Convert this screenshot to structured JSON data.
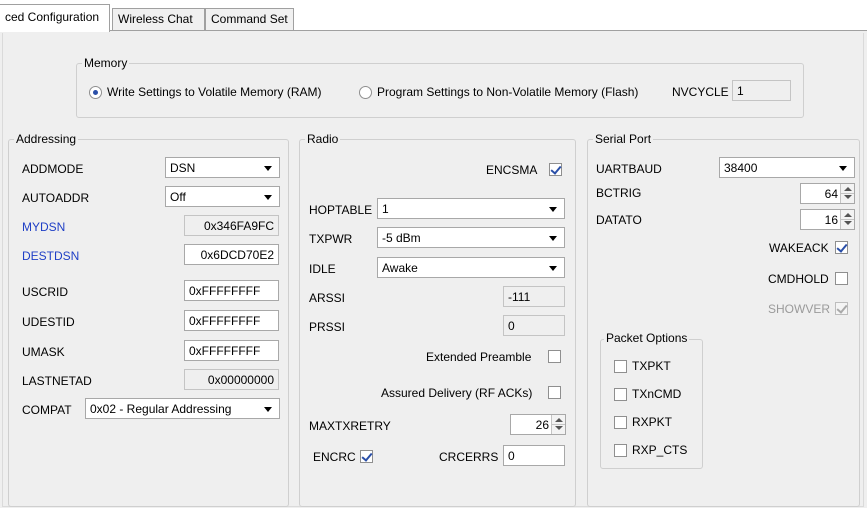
{
  "tabs": [
    "ced Configuration",
    "Wireless Chat",
    "Command Set"
  ],
  "memory": {
    "title": "Memory",
    "option_ram": "Write Settings to Volatile Memory (RAM)",
    "option_flash": "Program Settings to Non-Volatile Memory (Flash)",
    "selected": "option_ram",
    "nvcycle_label": "NVCYCLE",
    "nvcycle_value": "1"
  },
  "addressing": {
    "title": "Addressing",
    "addmode_label": "ADDMODE",
    "addmode_value": "DSN",
    "autoaddr_label": "AUTOADDR",
    "autoaddr_value": "Off",
    "mydsn_label": "MYDSN",
    "mydsn_value": "0x346FA9FC",
    "destdsn_label": "DESTDSN",
    "destdsn_value": "0x6DCD70E2",
    "uscrid_label": "USCRID",
    "uscrid_value": "0xFFFFFFFF",
    "udestid_label": "UDESTID",
    "udestid_value": "0xFFFFFFFF",
    "umask_label": "UMASK",
    "umask_value": "0xFFFFFFFF",
    "lastnetad_label": "LASTNETAD",
    "lastnetad_value": "0x00000000",
    "compat_label": "COMPAT",
    "compat_value": "0x02 - Regular Addressing"
  },
  "radio": {
    "title": "Radio",
    "encsma_label": "ENCSMA",
    "encsma_checked": true,
    "hoptable_label": "HOPTABLE",
    "hoptable_value": "1",
    "txpwr_label": "TXPWR",
    "txpwr_value": "-5 dBm",
    "idle_label": "IDLE",
    "idle_value": "Awake",
    "arssi_label": "ARSSI",
    "arssi_value": "-111",
    "prssi_label": "PRSSI",
    "prssi_value": "0",
    "extended_preamble_label": "Extended Preamble",
    "extended_preamble_checked": false,
    "assured_delivery_label": "Assured Delivery (RF ACKs)",
    "assured_delivery_checked": false,
    "maxtxretry_label": "MAXTXRETRY",
    "maxtxretry_value": "26",
    "encrc_label": "ENCRC",
    "encrc_checked": true,
    "crcerrs_label": "CRCERRS",
    "crcerrs_value": "0"
  },
  "serial": {
    "title": "Serial Port",
    "uartbaud_label": "UARTBAUD",
    "uartbaud_value": "38400",
    "bctrig_label": "BCTRIG",
    "bctrig_value": "64",
    "datato_label": "DATATO",
    "datato_value": "16",
    "wakeack_label": "WAKEACK",
    "wakeack_checked": true,
    "cmdhold_label": "CMDHOLD",
    "cmdhold_checked": false,
    "showver_label": "SHOWVER",
    "showver_checked": true,
    "packet_options": {
      "title": "Packet Options",
      "txpkt_label": "TXPKT",
      "txpkt_checked": false,
      "txncmd_label": "TXnCMD",
      "txncmd_checked": false,
      "rxpkt_label": "RXPKT",
      "rxpkt_checked": false,
      "rxpcts_label": "RXP_CTS",
      "rxpcts_checked": false
    }
  },
  "colors": {
    "blue_label": "#1f3fc6",
    "panel_bg": "#efefef",
    "check_mark": "#2a4fa8"
  }
}
